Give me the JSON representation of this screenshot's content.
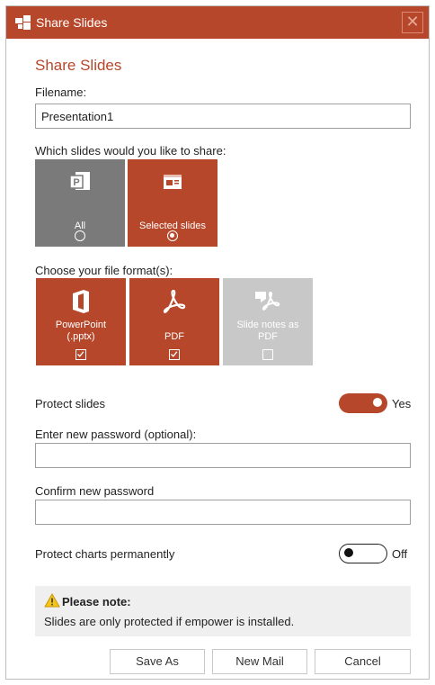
{
  "window": {
    "title": "Share Slides",
    "close_glyph": "✕"
  },
  "heading": "Share Slides",
  "filename": {
    "label": "Filename:",
    "value": "Presentation1"
  },
  "slides": {
    "label": "Which slides would you like to share:",
    "options": [
      {
        "label": "All",
        "icon": "powerpoint-file-icon",
        "selected": false
      },
      {
        "label": "Selected slides",
        "icon": "slide-icon",
        "selected": true
      }
    ]
  },
  "formats": {
    "label": "Choose your file format(s):",
    "options": [
      {
        "label_line1": "PowerPoint",
        "label_line2": "(.pptx)",
        "icon": "office-icon",
        "checked": true,
        "enabled": true
      },
      {
        "label_line1": "PDF",
        "label_line2": "",
        "icon": "pdf-icon",
        "checked": true,
        "enabled": true
      },
      {
        "label_line1": "Slide notes as",
        "label_line2": "PDF",
        "icon": "notes-pdf-icon",
        "checked": false,
        "enabled": false
      }
    ]
  },
  "protect_slides": {
    "label": "Protect slides",
    "state_text": "Yes",
    "on": true
  },
  "password": {
    "label": "Enter new password (optional):",
    "value": ""
  },
  "confirm_password": {
    "label": "Confirm new password",
    "value": ""
  },
  "protect_charts": {
    "label": "Protect charts permanently",
    "state_text": "Off",
    "on": false
  },
  "note": {
    "title": "Please note:",
    "body": "Slides are only protected if empower is installed."
  },
  "buttons": {
    "save_as": "Save As",
    "new_mail": "New Mail",
    "cancel": "Cancel"
  },
  "colors": {
    "accent": "#b7472a",
    "tile_gray": "#7a7a7a",
    "tile_disabled": "#c8c8c8"
  }
}
